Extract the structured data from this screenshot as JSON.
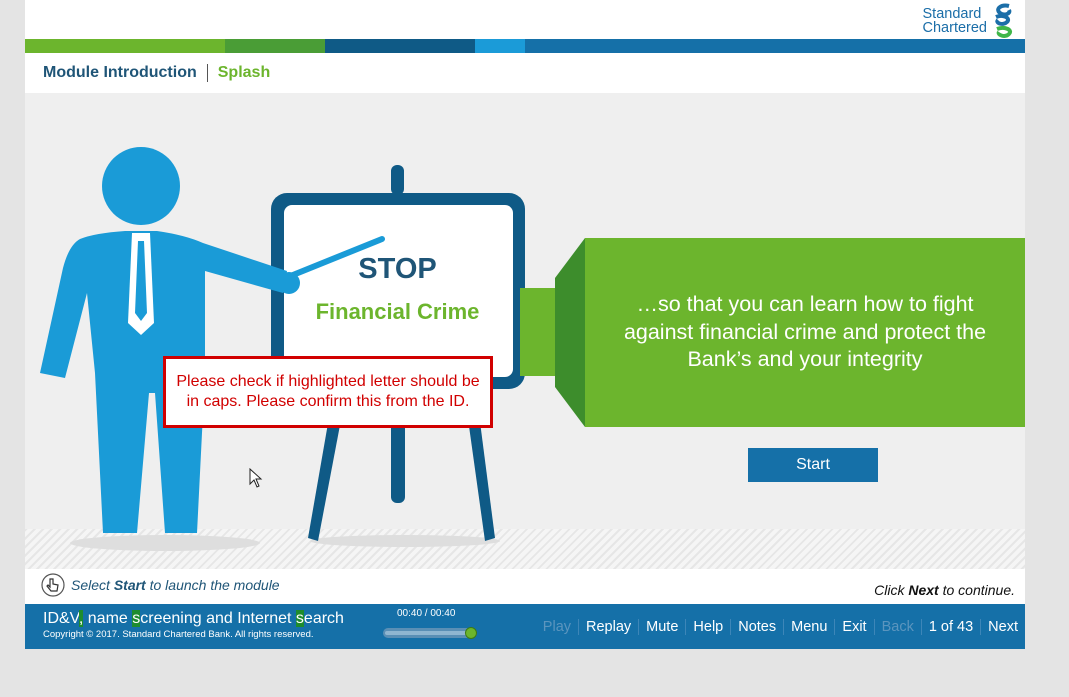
{
  "brand": {
    "logo_text_line1": "Standard",
    "logo_text_line2": "Chartered"
  },
  "breadcrumb": {
    "module": "Module Introduction",
    "page": "Splash"
  },
  "board": {
    "stop": "STOP",
    "subtitle": "Financial Crime"
  },
  "banner": {
    "text": "…so that you can learn how to fight against financial crime and protect the Bank’s and your integrity"
  },
  "review_note": {
    "text": "Please check if highlighted letter should be in caps. Please confirm this from the ID."
  },
  "start_button": {
    "label": "Start"
  },
  "hint": {
    "prefix": "Select",
    "action": "Start",
    "suffix": "to launch the module"
  },
  "continue_hint": {
    "prefix": "Click",
    "action": "Next",
    "suffix": "to continue."
  },
  "footer": {
    "course_title_parts": [
      "ID&V",
      ",",
      " ",
      "name ",
      "s",
      "creening and Internet ",
      "s",
      "earch"
    ],
    "copyright": "Copyright © 2017. Standard Chartered Bank. All rights reserved.",
    "time": "00:40 / 00:40",
    "progress": 1.0,
    "nav": {
      "play": "Play",
      "replay": "Replay",
      "mute": "Mute",
      "help": "Help",
      "notes": "Notes",
      "menu": "Menu",
      "exit": "Exit",
      "back": "Back",
      "page_indicator": "1 of 43",
      "next": "Next"
    }
  },
  "colors": {
    "brand_blue": "#1570a8",
    "brand_green": "#6cb52d",
    "dark_blue": "#1f5577",
    "figure_blue": "#1a9bd7",
    "alert_red": "#d10000"
  },
  "icons": [
    "standard-chartered-logo-icon",
    "hand-pointer-icon",
    "mouse-cursor-icon"
  ]
}
